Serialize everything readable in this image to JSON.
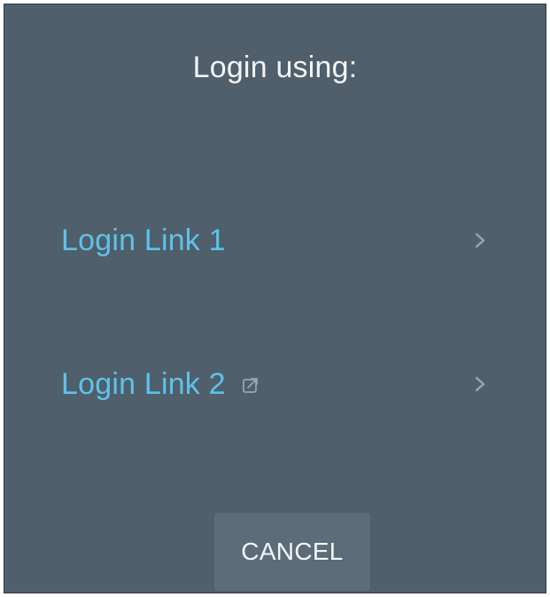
{
  "dialog": {
    "title": "Login using:",
    "links": [
      {
        "label": "Login Link 1",
        "external": false,
        "chevron_icon": "chevron-right-icon"
      },
      {
        "label": "Login Link 2",
        "external": true,
        "external_icon": "external-link-icon",
        "chevron_icon": "chevron-right-icon"
      }
    ],
    "cancel_label": "CANCEL"
  },
  "colors": {
    "background": "#4f5f6b",
    "link": "#5ec3ea",
    "text": "#f2f5f7",
    "button": "#5c6c78",
    "icon_muted": "#9aa6af"
  }
}
